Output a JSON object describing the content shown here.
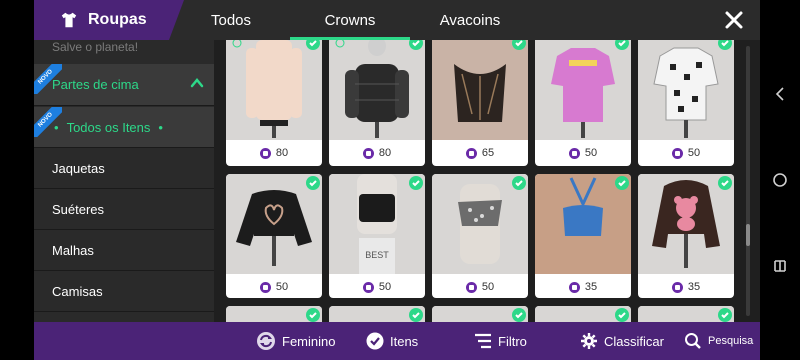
{
  "header": {
    "title": "Roupas",
    "tabs": [
      {
        "label": "Todos",
        "active": false
      },
      {
        "label": "Crowns",
        "active": true
      },
      {
        "label": "Avacoins",
        "active": false
      }
    ]
  },
  "sidebar": {
    "faded_item": "Salve o planeta!",
    "group": {
      "label": "Partes de cima",
      "badge": "NOVO"
    },
    "sub_item": {
      "label": "Todos os Itens",
      "badge": "NOVO"
    },
    "items": [
      "Jaquetas",
      "Suéteres",
      "Malhas",
      "Camisas"
    ]
  },
  "grid": {
    "rows": [
      [
        {
          "price": "80",
          "garment": "beige-hoodie",
          "license_icon": true
        },
        {
          "price": "80",
          "garment": "black-puffer",
          "license_icon": true
        },
        {
          "price": "65",
          "garment": "lace-corset",
          "license_icon": false
        },
        {
          "price": "50",
          "garment": "pink-print-tee",
          "license_icon": false
        },
        {
          "price": "50",
          "garment": "black-white-pattern-tee",
          "license_icon": false
        }
      ],
      [
        {
          "price": "50",
          "garment": "black-heart-sweater",
          "license_icon": false
        },
        {
          "price": "50",
          "garment": "black-crop-top-best",
          "license_icon": false
        },
        {
          "price": "50",
          "garment": "bandana-tube-top",
          "license_icon": false
        },
        {
          "price": "35",
          "garment": "blue-halter-top",
          "license_icon": false
        },
        {
          "price": "35",
          "garment": "teddy-bear-hoodie",
          "license_icon": false
        }
      ]
    ]
  },
  "bottombar": {
    "gender": "Feminino",
    "items": "Itens",
    "filter": "Filtro",
    "sort": "Classificar",
    "search": "Pesquisa"
  },
  "colors": {
    "brand_purple": "#4b2377",
    "accent_green": "#2dd889",
    "badge_blue": "#1e7fe0",
    "coin_purple": "#6a2aa8"
  }
}
